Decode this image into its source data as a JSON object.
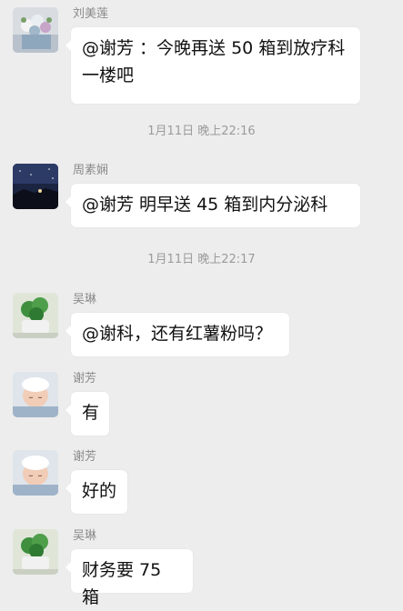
{
  "messages": [
    {
      "sender": "刘美莲",
      "text": "@谢芳 ：今晚再送 50 箱到放疗科一楼吧",
      "avatar": "flowers-avatar-icon"
    },
    {
      "sender": "周素娴",
      "text": "@谢芳  明早送 45 箱到内分泌科",
      "avatar": "night-sky-avatar-icon"
    },
    {
      "sender": "吴琳",
      "text": "@谢科，还有红薯粉吗？",
      "avatar": "plant-avatar-icon"
    },
    {
      "sender": "谢芳",
      "text": "有",
      "avatar": "baby-avatar-icon"
    },
    {
      "sender": "谢芳",
      "text": "好的",
      "avatar": "baby-avatar-icon"
    },
    {
      "sender": "吴琳",
      "text": "财务要 75 箱",
      "avatar": "plant-avatar-icon"
    }
  ],
  "timestamps": [
    "1月11日 晚上22:16",
    "1月11日 晚上22:17"
  ],
  "colors": {
    "background": "#ededed",
    "bubble": "#ffffff",
    "sender": "#8a8a8a",
    "timestamp": "#9b9b9b"
  }
}
